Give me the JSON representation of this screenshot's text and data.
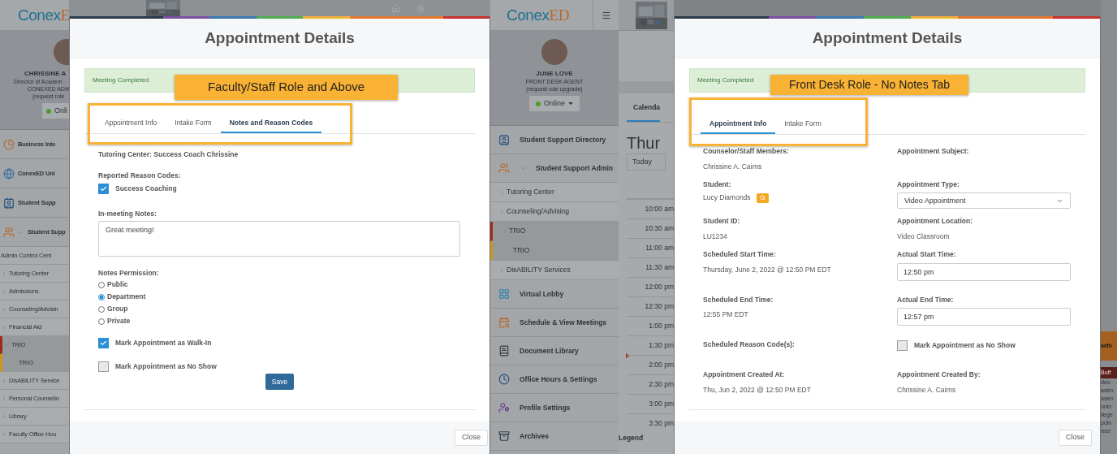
{
  "left_screen": {
    "sidebar": {
      "logo": {
        "main": "Conex",
        "accent": "E"
      },
      "profile": {
        "name": "CHRISSINE A",
        "title": "Director of Academ",
        "org": "CONEXED ADM",
        "note": "(request role",
        "status": "Onli"
      },
      "nav": [
        {
          "kind": "link",
          "label": "Business Inte"
        },
        {
          "kind": "link",
          "label": "ConexED Uni"
        },
        {
          "kind": "link",
          "label": "Student Supp"
        },
        {
          "kind": "group",
          "label": "Student Supp",
          "expanded": true,
          "children": [
            {
              "kind": "plain",
              "label": "Admin Control Cent",
              "selected": false
            },
            {
              "kind": "folder",
              "label": "Tutoring Center",
              "expanded": false,
              "selected": false
            },
            {
              "kind": "folder",
              "label": "Admissions",
              "expanded": false,
              "selected": false
            },
            {
              "kind": "folder",
              "label": "Counseling/Advisin",
              "expanded": false,
              "selected": false
            },
            {
              "kind": "folder",
              "label": "Financial Aid",
              "expanded": false,
              "selected": false
            },
            {
              "kind": "folder",
              "label": "TRIO",
              "expanded": true,
              "selected": true,
              "children": [
                {
                  "label": "TRIO",
                  "selected": true
                }
              ]
            },
            {
              "kind": "folder",
              "label": "DisABILITY Service",
              "expanded": false,
              "selected": false
            },
            {
              "kind": "folder",
              "label": "Personal Counselin",
              "expanded": false,
              "selected": false
            },
            {
              "kind": "folder",
              "label": "Library",
              "expanded": false,
              "selected": false
            },
            {
              "kind": "folder",
              "label": "Faculty Office Hou",
              "expanded": false,
              "selected": false
            }
          ]
        }
      ]
    },
    "modal": {
      "title": "Appointment Details",
      "status": "Meeting Completed",
      "callout": "Faculty/Staff Role and Above",
      "tabs": [
        {
          "label": "Appointment Info",
          "selected": false
        },
        {
          "label": "Intake Form",
          "selected": false
        },
        {
          "label": "Notes and Reason Codes",
          "selected": true
        }
      ],
      "notes_form": {
        "heading": "Tutoring Center: Success Coach Chrissine",
        "reason_codes": {
          "label": "Reported Reason Codes:",
          "options": [
            {
              "label": "Success Coaching",
              "checked": true
            }
          ]
        },
        "notes": {
          "label": "In-meeting Notes:",
          "value": "Great meeting!"
        },
        "permission": {
          "label": "Notes Permission:",
          "options": [
            {
              "label": "Public",
              "selected": false
            },
            {
              "label": "Department",
              "selected": true
            },
            {
              "label": "Group",
              "selected": false
            },
            {
              "label": "Private",
              "selected": false
            }
          ]
        },
        "flags": [
          {
            "label": "Mark Appointment as Walk-In",
            "checked": true
          },
          {
            "label": "Mark Appointment as No Show",
            "checked": false
          }
        ],
        "save_button": "Save"
      },
      "close_button": "Close"
    }
  },
  "right_screen": {
    "sidebar": {
      "logo": {
        "main": "Conex",
        "accent": "ED"
      },
      "profile": {
        "name": "JUNE LOVE",
        "title": "FRONT DESK AGENT",
        "note": "(request role upgrade)",
        "status": "Online"
      },
      "nav": [
        {
          "kind": "link",
          "label": "Student Support Directory"
        },
        {
          "kind": "group",
          "label": "Student Support Admin",
          "expanded": true,
          "children": [
            {
              "kind": "folder",
              "label": "Tutoring Center",
              "expanded": false,
              "selected": false
            },
            {
              "kind": "folder",
              "label": "Counseling/Advising",
              "expanded": false,
              "selected": false
            },
            {
              "kind": "folder",
              "label": "TRIO",
              "expanded": true,
              "selected": true,
              "children": [
                {
                  "label": "TRIO",
                  "selected": true
                }
              ]
            },
            {
              "kind": "folder",
              "label": "DisABILITY Services",
              "expanded": false,
              "selected": false
            }
          ]
        },
        {
          "kind": "link",
          "label": "Virtual Lobby"
        },
        {
          "kind": "link",
          "label": "Schedule & View Meetings"
        },
        {
          "kind": "link",
          "label": "Document Library"
        },
        {
          "kind": "link",
          "label": "Office Hours & Settings"
        },
        {
          "kind": "link",
          "label": "Profile Settings"
        },
        {
          "kind": "link",
          "label": "Archives"
        }
      ]
    },
    "calendar": {
      "tab": "Calenda",
      "heading": "Thur",
      "today_button": "Today",
      "times": [
        "10:00 am",
        "10:30 am",
        "11:00 am",
        "11:30 am",
        "12:00 pm",
        "12:30 pm",
        "1:00 pm",
        "1:30 pm",
        "2:00 pm",
        "2:30 pm",
        "3:00 pm",
        "3:30 pm"
      ],
      "legend": "Legend"
    },
    "modal": {
      "title": "Appointment Details",
      "status": "Meeting Completed",
      "callout": "Front Desk Role - No Notes Tab",
      "tabs": [
        {
          "label": "Appointment Info",
          "selected": true
        },
        {
          "label": "Intake Form",
          "selected": false
        }
      ],
      "info_fields": [
        {
          "kind": "text",
          "label": "Counselor/Staff Members:",
          "value": "Chrissine A. Cairns"
        },
        {
          "kind": "text",
          "label": "Appointment Subject:"
        },
        {
          "kind": "student",
          "label": "Student:",
          "value": "Lucy Diamonds"
        },
        {
          "kind": "select",
          "label": "Appointment Type:",
          "value": "Video Appointment"
        },
        {
          "kind": "text",
          "label": "Student ID:",
          "value": "LU1234"
        },
        {
          "kind": "text",
          "label": "Appointment Location:",
          "value": "Video Classroom"
        },
        {
          "kind": "text",
          "label": "Scheduled Start Time:",
          "value": "Thursday, June 2, 2022 @ 12:50 PM EDT"
        },
        {
          "kind": "input",
          "label": "Actual Start Time:",
          "value": "12:50 pm"
        },
        {
          "kind": "text",
          "label": "Scheduled End Time:",
          "value": "12:55 PM EDT"
        },
        {
          "kind": "input",
          "label": "Actual End Time:",
          "value": "12:57 pm"
        },
        {
          "kind": "text",
          "label": "Scheduled Reason Code(s):"
        },
        {
          "kind": "checkbox",
          "label": "Mark Appointment as No Show",
          "checked": false
        },
        {
          "kind": "text",
          "label": "Appointment Created At:",
          "value": "Thu, Jun 2, 2022 @ 12:50 PM EDT"
        },
        {
          "kind": "text",
          "label": "Appointment Created By:",
          "value": "Chrissine A. Cairns"
        }
      ],
      "close_button": "Close"
    },
    "edge": {
      "event": "with",
      "tag": "Buff",
      "notes": [
        "des:",
        "aden",
        "aden",
        "nnin",
        "llege",
        "poin",
        "reer"
      ]
    }
  }
}
